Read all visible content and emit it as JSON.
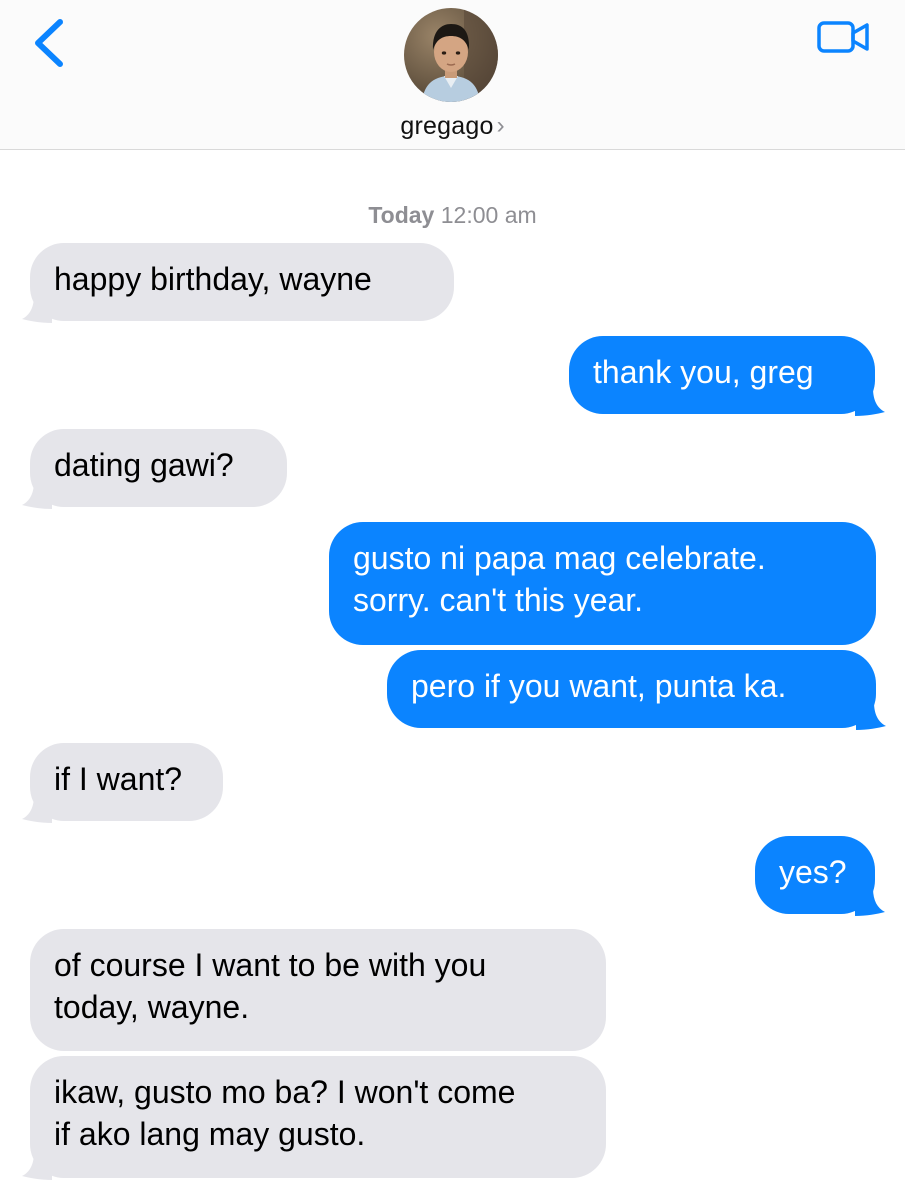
{
  "colors": {
    "accent": "#0b84ff",
    "incoming_bubble": "#e5e5ea",
    "outgoing_bubble": "#0b84ff",
    "timestamp_text": "#8e8e93"
  },
  "header": {
    "back_icon": "chevron-left-icon",
    "video_icon": "video-camera-icon",
    "contact_name": "gregago",
    "contact_chevron": "›"
  },
  "timestamp": {
    "day": "Today",
    "time": "12:00 am"
  },
  "messages": [
    {
      "direction": "incoming",
      "lines": [
        "happy birthday, wayne"
      ]
    },
    {
      "direction": "outgoing",
      "lines": [
        "thank you, greg"
      ]
    },
    {
      "direction": "incoming",
      "lines": [
        "dating gawi?"
      ]
    },
    {
      "direction": "outgoing",
      "lines": [
        "gusto ni papa mag celebrate.",
        "sorry. can't this year."
      ]
    },
    {
      "direction": "outgoing",
      "lines": [
        "pero if you want, punta ka."
      ]
    },
    {
      "direction": "incoming",
      "lines": [
        "if I want?"
      ]
    },
    {
      "direction": "outgoing",
      "lines": [
        "yes?"
      ]
    },
    {
      "direction": "incoming",
      "lines": [
        "of course I want to be with you",
        "today, wayne."
      ]
    },
    {
      "direction": "incoming",
      "lines": [
        "ikaw, gusto mo ba? I won't come",
        "if ako lang may gusto."
      ]
    }
  ]
}
